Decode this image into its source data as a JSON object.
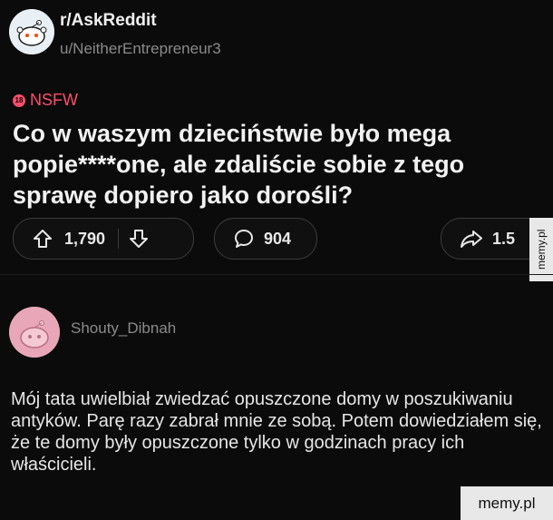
{
  "post": {
    "subreddit": "r/AskReddit",
    "author": "u/NeitherEntrepreneur3",
    "nsfw_label": "NSFW",
    "nsfw_badge": "18",
    "title": "Co w waszym dzieciństwie było mega popie****one, ale zdaliście sobie z tego sprawę dopiero jako dorośli?",
    "upvotes": "1,790",
    "comments": "904",
    "shares": "1.5"
  },
  "comment": {
    "author": "Shouty_Dibnah",
    "text": "Mój tata uwielbiał zwiedzać opuszczone domy w poszukiwaniu antyków. Parę razy zabrał mnie ze sobą. Potem dowiedziałem się, że te domy były opuszczone tylko w godzinach pracy ich właścicieli."
  },
  "watermark": {
    "side": "memy.pl",
    "corner": "memy.pl"
  },
  "colors": {
    "background": "#0b0b0b",
    "nsfw": "#ff4d6a",
    "muted_text": "#8a8a8a",
    "pill_border": "#3c3c3c"
  },
  "icons": [
    "reddit-avatar-icon",
    "upvote-icon",
    "downvote-icon",
    "comment-icon",
    "share-icon"
  ]
}
